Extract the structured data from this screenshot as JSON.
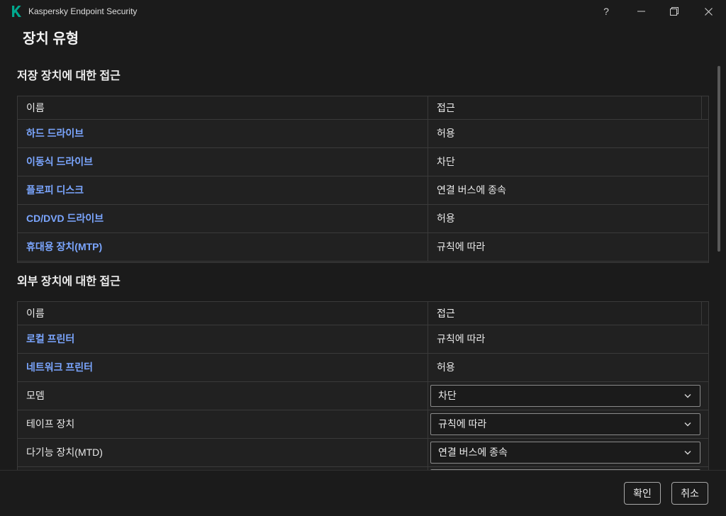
{
  "window": {
    "title": "Kaspersky Endpoint Security",
    "help_label": "?"
  },
  "page": {
    "title": "장치 유형"
  },
  "storage": {
    "heading": "저장 장치에 대한 접근",
    "columns": {
      "name": "이름",
      "access": "접근"
    },
    "rows": [
      {
        "name": "하드 드라이브",
        "access": "허용"
      },
      {
        "name": "이동식 드라이브",
        "access": "차단"
      },
      {
        "name": "플로피 디스크",
        "access": "연결 버스에 종속"
      },
      {
        "name": "CD/DVD 드라이브",
        "access": "허용"
      },
      {
        "name": "휴대용 장치(MTP)",
        "access": "규칙에 따라"
      }
    ]
  },
  "external": {
    "heading": "외부 장치에 대한 접근",
    "columns": {
      "name": "이름",
      "access": "접근"
    },
    "rows": [
      {
        "name": "로컬 프린터",
        "access": "규칙에 따라"
      },
      {
        "name": "네트워크 프린터",
        "access": "허용"
      },
      {
        "name": "모뎀",
        "access": "차단"
      },
      {
        "name": "테이프 장치",
        "access": "규칙에 따라"
      },
      {
        "name": "다기능 장치(MTD)",
        "access": "연결 버스에 종속"
      }
    ]
  },
  "footer": {
    "ok_label": "확인",
    "cancel_label": "취소"
  },
  "icons": {
    "logo": "kaspersky-logo-icon",
    "help": "help-icon",
    "minimize": "minimize-icon",
    "restore": "restore-icon",
    "close": "close-icon",
    "dropdown": "chevron-down-icon"
  },
  "colors": {
    "accent": "#00a88e",
    "link": "#7ba6ff",
    "background": "#1b1b1b",
    "border": "#3a3a3a"
  }
}
